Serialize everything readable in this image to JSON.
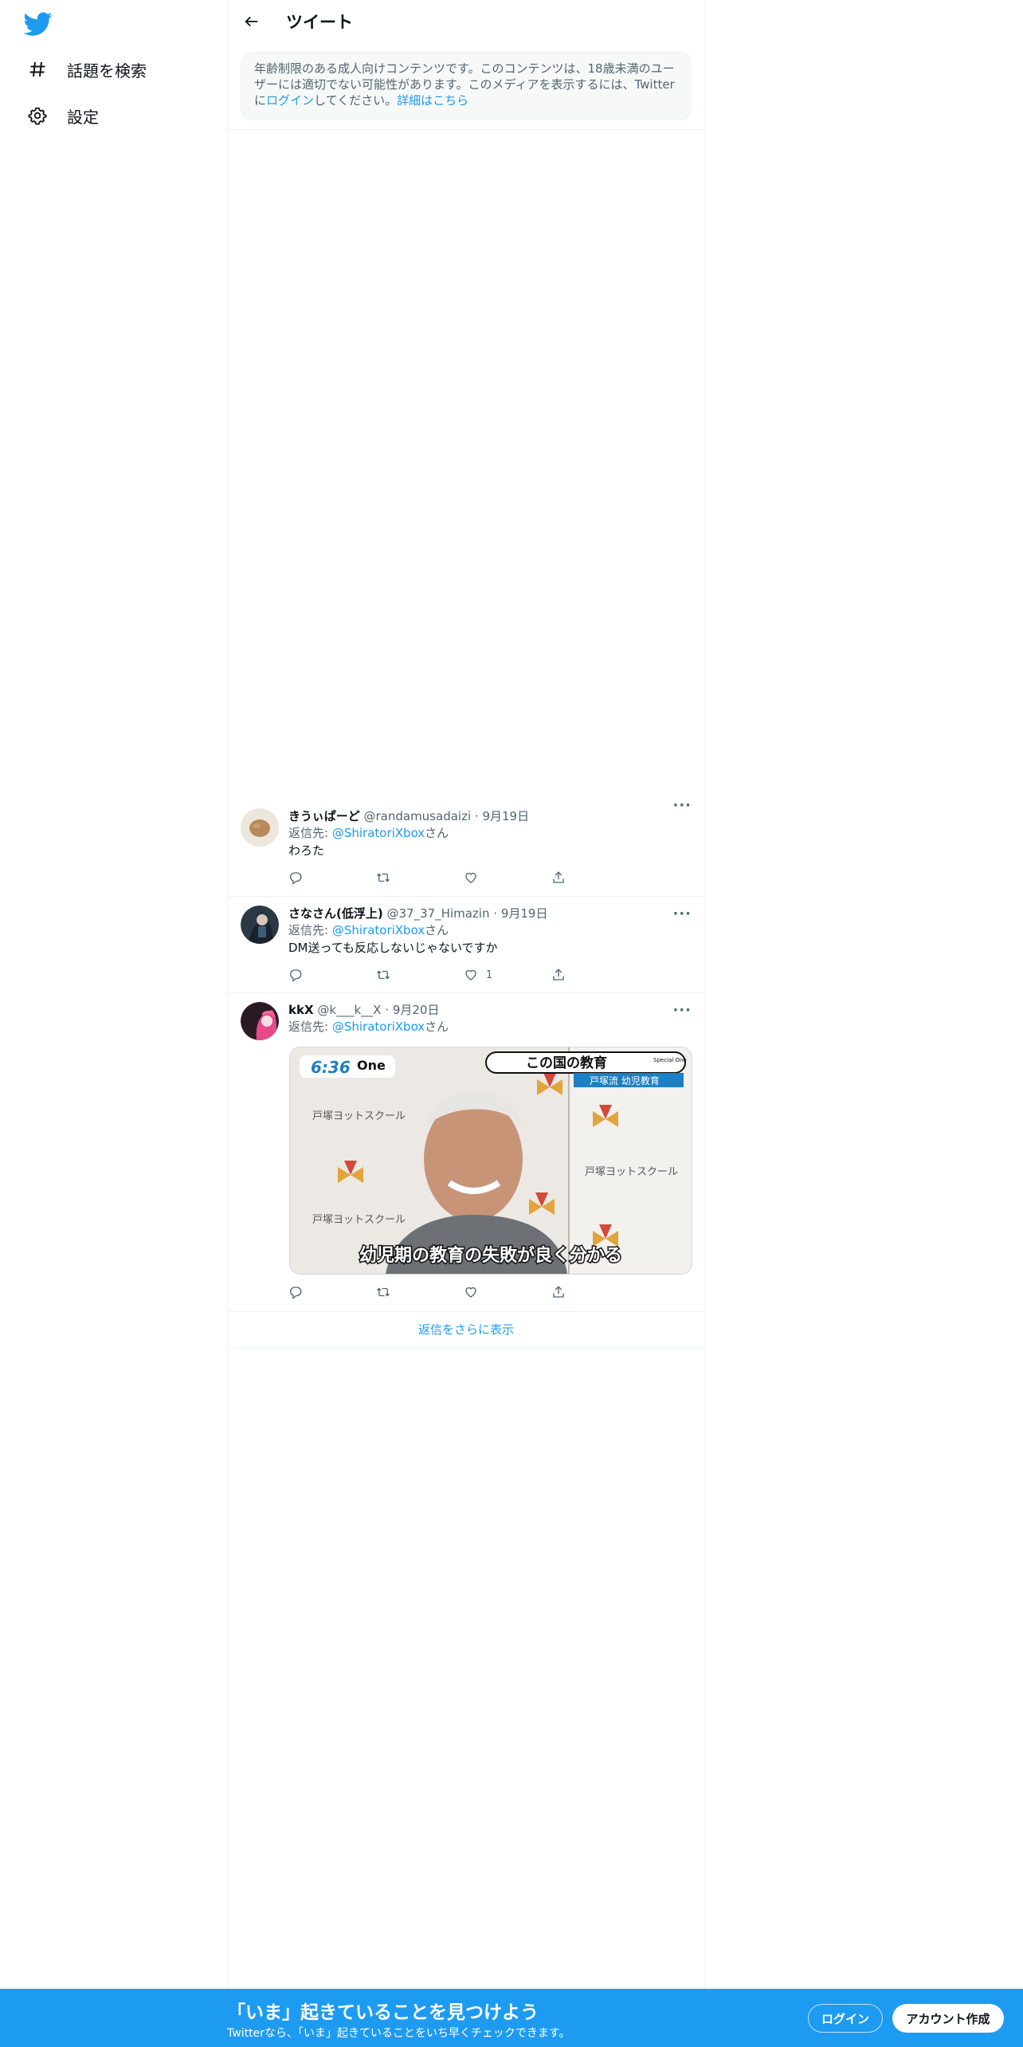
{
  "sidebar": {
    "logo_icon": "twitter-bird-icon",
    "items": [
      {
        "label": "話題を検索",
        "icon": "hashtag-icon"
      },
      {
        "label": "設定",
        "icon": "gear-icon"
      }
    ]
  },
  "header": {
    "title": "ツイート",
    "back_icon": "arrow-left-icon"
  },
  "notice": {
    "text_1": "年齢制限のある成人向けコンテンツです。このコンテンツは、18歳未満のユーザーには適切でない可能性があります。このメディアを表示するには、Twitterに",
    "login_link": "ログイン",
    "text_2": "してください。",
    "details_link": "詳細はこちら"
  },
  "replies": [
    {
      "name": "きうぃぱーど",
      "handle": "@randamusadaizi",
      "date": "9月19日",
      "reply_prefix": "返信先: ",
      "reply_to": "@ShiratoriXbox",
      "reply_suffix": "さん",
      "text": "わろた",
      "like_count": ""
    },
    {
      "name": "さなさん(低浮上)",
      "handle": "@37_37_Himazin",
      "date": "9月19日",
      "reply_prefix": "返信先: ",
      "reply_to": "@ShiratoriXbox",
      "reply_suffix": "さん",
      "text": "DM送っても反応しないじゃないですか",
      "like_count": "1"
    },
    {
      "name": "kkX",
      "handle": "@k___k__X",
      "date": "9月20日",
      "reply_prefix": "返信先: ",
      "reply_to": "@ShiratoriXbox",
      "reply_suffix": "さん",
      "text": "",
      "like_count": "",
      "media": {
        "time": "6:36",
        "brand": "One",
        "headline": "この国の教育",
        "subheadline": "戸塚流 幼児教育",
        "caption": "幼児期の教育の失敗が良く分かる",
        "wall_text": "戸塚ヨットスクール",
        "special_label": "Special One"
      }
    }
  ],
  "more_dots": "···",
  "show_more_replies": "返信をさらに表示",
  "banner": {
    "headline": "「いま」起きていることを見つけよう",
    "subtext": "Twitterなら、「いま」起きていることをいち早くチェックできます。",
    "login_label": "ログイン",
    "signup_label": "アカウント作成"
  },
  "colors": {
    "accent": "#1d9bf0",
    "text": "#0f1419",
    "muted": "#536471"
  }
}
